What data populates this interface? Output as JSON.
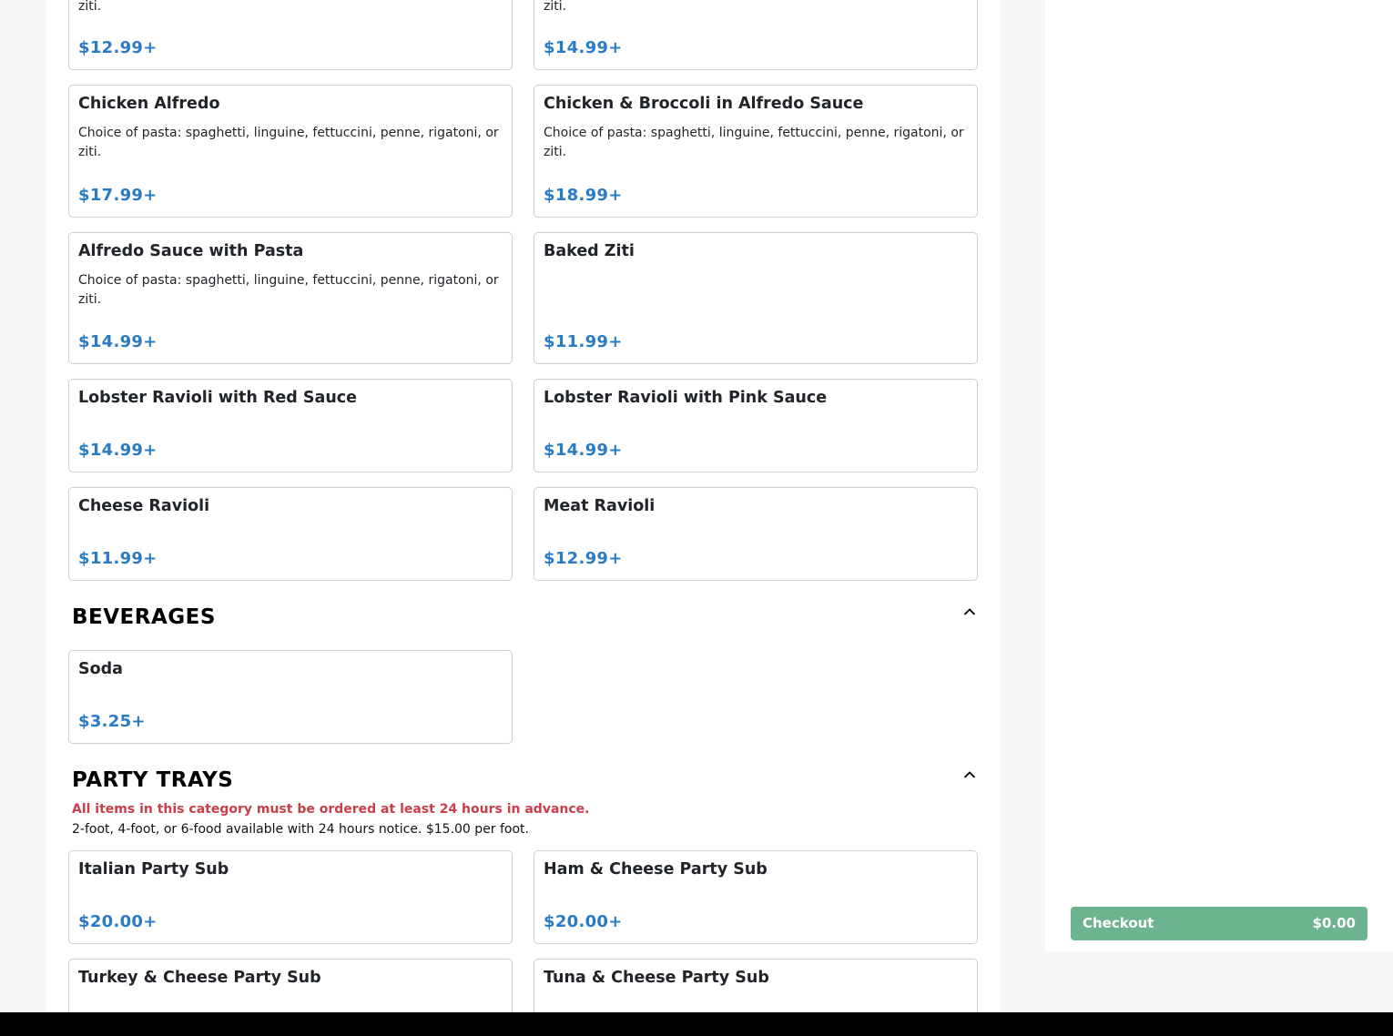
{
  "sections": {
    "pasta": {
      "partial_items": [
        {
          "desc": "ziti.",
          "price": "$12.99+"
        },
        {
          "desc": "ziti.",
          "price": "$14.99+"
        }
      ],
      "items": [
        {
          "name": "Chicken Alfredo",
          "desc": "Choice of pasta: spaghetti, linguine, fettuccini, penne, rigatoni, or ziti.",
          "price": "$17.99+"
        },
        {
          "name": "Chicken & Broccoli in Alfredo Sauce",
          "desc": "Choice of pasta: spaghetti, linguine, fettuccini, penne, rigatoni, or ziti.",
          "price": "$18.99+"
        },
        {
          "name": "Alfredo Sauce with Pasta",
          "desc": "Choice of pasta: spaghetti, linguine, fettuccini, penne, rigatoni, or ziti.",
          "price": "$14.99+"
        },
        {
          "name": "Baked Ziti",
          "desc": "",
          "price": "$11.99+"
        },
        {
          "name": "Lobster Ravioli with Red Sauce",
          "price": "$14.99+"
        },
        {
          "name": "Lobster Ravioli with Pink Sauce",
          "price": "$14.99+"
        },
        {
          "name": "Cheese Ravioli",
          "price": "$11.99+"
        },
        {
          "name": "Meat Ravioli",
          "price": "$12.99+"
        }
      ]
    },
    "beverages": {
      "title": "BEVERAGES",
      "collapse_icon": "chevron-up-icon",
      "items": [
        {
          "name": "Soda",
          "price": "$3.25+"
        }
      ]
    },
    "party_trays": {
      "title": "PARTY TRAYS",
      "collapse_icon": "chevron-up-icon",
      "advance_notice": "All items in this category must be ordered at least 24 hours in advance.",
      "description": "2-foot, 4-foot, or 6-food available with 24 hours notice. $15.00 per foot.",
      "items": [
        {
          "name": "Italian Party Sub",
          "price": "$20.00+"
        },
        {
          "name": "Ham & Cheese Party Sub",
          "price": "$20.00+"
        },
        {
          "name": "Turkey & Cheese Party Sub"
        },
        {
          "name": "Tuna & Cheese Party Sub"
        }
      ]
    }
  },
  "cart": {
    "checkout_label": "Checkout",
    "total": "$0.00"
  },
  "colors": {
    "price": "#2a7bc4",
    "notice_red": "#cc3d4a",
    "checkout_bg": "#6db38f"
  }
}
